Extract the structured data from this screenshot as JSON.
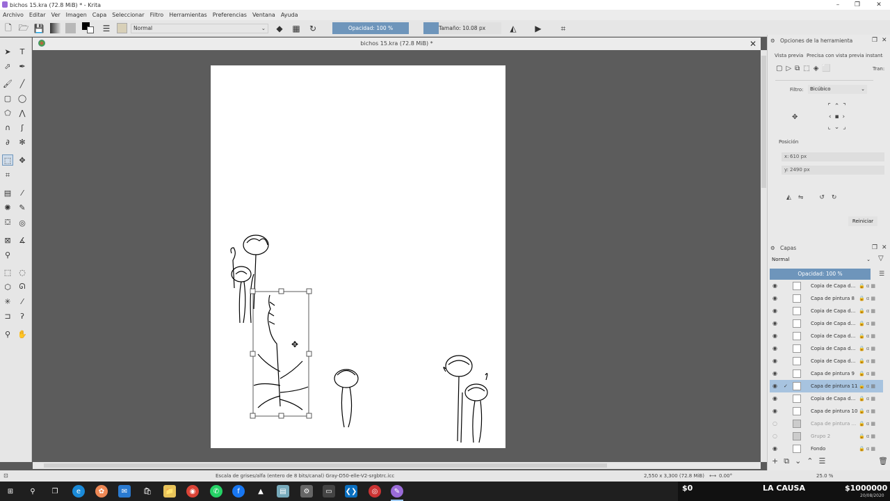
{
  "window": {
    "title": "bichos 15.kra (72.8 MiB) * - Krita"
  },
  "menu": [
    "Archivo",
    "Editar",
    "Ver",
    "Imagen",
    "Capa",
    "Seleccionar",
    "Filtro",
    "Herramientas",
    "Preferencias",
    "Ventana",
    "Ayuda"
  ],
  "toolbar": {
    "blend_mode": "Normal",
    "opacity": "Opacidad: 100 %",
    "size": "Tamaño: 10.08 px"
  },
  "document": {
    "tab_title": "bichos 15.kra (72.8 MiB) *"
  },
  "tool_options": {
    "title": "Opciones de la herramienta",
    "preview_label": "Vista previa",
    "preview_value": "Precisa con vista previa instantán",
    "trans_label": "Tran:",
    "filter_label": "Filtro:",
    "filter_value": "Bicúbico",
    "position_label": "Posición",
    "x_label": "x:",
    "x_value": "610 px",
    "y_label": "y:",
    "y_value": "2490 px",
    "reset": "Reiniciar"
  },
  "layers": {
    "title": "Capas",
    "blend": "Normal",
    "opacity": "Opacidad: 100 %",
    "items": [
      {
        "name": "Copia de Capa d..."
      },
      {
        "name": "Capa de pintura 8"
      },
      {
        "name": "Copia de Capa d..."
      },
      {
        "name": "Copia de Capa d..."
      },
      {
        "name": "Copia de Capa d..."
      },
      {
        "name": "Copia de Capa d..."
      },
      {
        "name": "Copia de Capa d..."
      },
      {
        "name": "Capa de pintura 9"
      },
      {
        "name": "Capa de pintura 11"
      },
      {
        "name": "Copia de Capa d..."
      },
      {
        "name": "Capa de pintura 10"
      },
      {
        "name": "Capa de pintura ..."
      },
      {
        "name": "Grupo 2"
      },
      {
        "name": "Fondo"
      }
    ]
  },
  "status": {
    "color_space": "Escala de grises/alfa (entero de 8 bits/canal)  Gray-D50-elle-V2-srgbtrc.icc",
    "dimensions": "2,550 x 3,300 (72.8 MiB)",
    "rotation": "0.00°",
    "zoom": "25.0 %"
  },
  "ticker": {
    "left": "$0",
    "center": "LA CAUSA",
    "right": "$1000000",
    "date": "20/08/2020"
  }
}
